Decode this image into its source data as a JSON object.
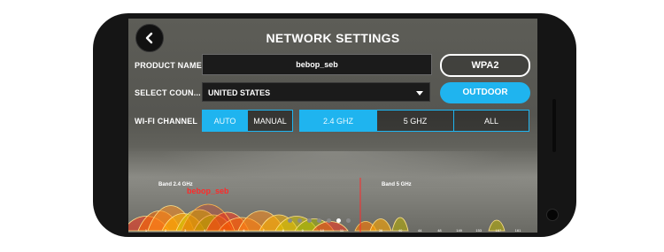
{
  "header": {
    "title": "NETWORK SETTINGS"
  },
  "form": {
    "product_name_label": "PRODUCT NAME",
    "product_name_value": "bebop_seb",
    "security_label": "WPA2",
    "country_label": "SELECT COUN...",
    "country_value": "UNITED STATES",
    "environment_label": "OUTDOOR",
    "wifi_channel_label": "WI-FI CHANNEL"
  },
  "channel_mode": {
    "options": [
      "AUTO",
      "MANUAL"
    ],
    "selected": "AUTO"
  },
  "band": {
    "options": [
      "2.4 GHZ",
      "5 GHZ",
      "ALL"
    ],
    "selected": "2.4 GHZ"
  },
  "spectrum": {
    "band_24_label": "Band 2.4 GHz",
    "band_5_label": "Band 5 GHz",
    "ssid": "bebop_seb",
    "ticks_24": [
      "1",
      "2",
      "3",
      "4",
      "5",
      "6",
      "7",
      "8",
      "9",
      "10",
      "11"
    ],
    "ticks_5": [
      "36",
      "40",
      "44",
      "48",
      "149",
      "153",
      "157",
      "161"
    ]
  },
  "pager": {
    "count": 7,
    "active_index": 5
  },
  "colors": {
    "accent": "#1fb4ef",
    "ssid_highlight": "#ff2a2a"
  }
}
